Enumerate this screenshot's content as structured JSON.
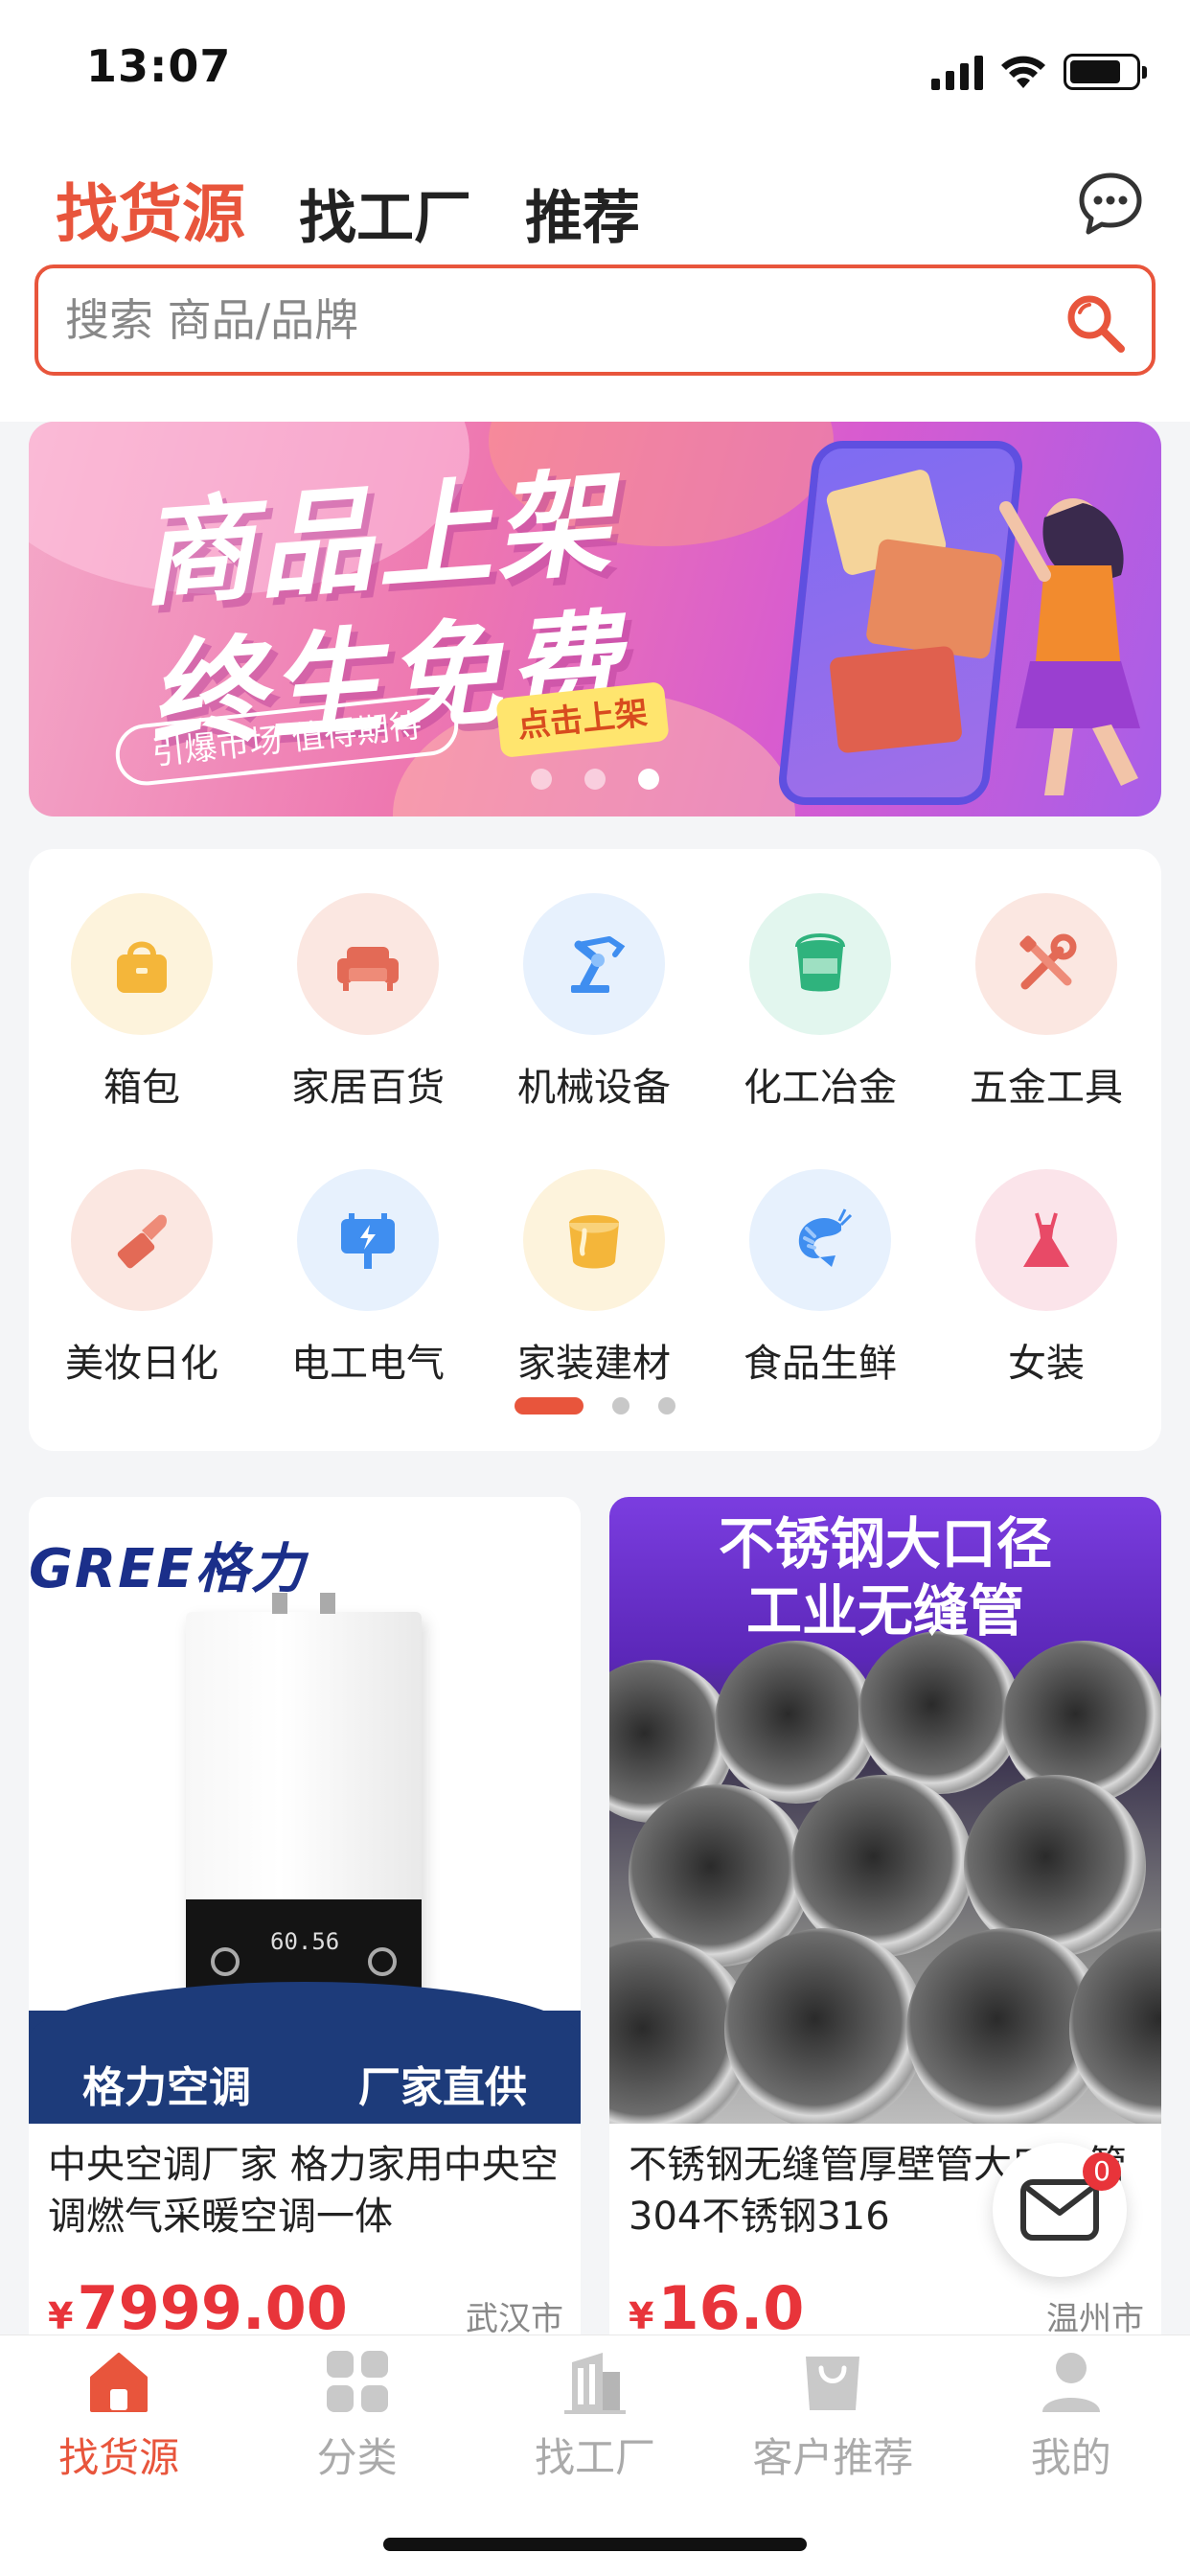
{
  "status_bar": {
    "time": "13:07"
  },
  "header": {
    "tabs": [
      {
        "label": "找货源",
        "active": true
      },
      {
        "label": "找工厂",
        "active": false
      },
      {
        "label": "推荐",
        "active": false
      }
    ],
    "message_icon": "chat-bubble-icon"
  },
  "search": {
    "placeholder": "搜索 商品/品牌",
    "icon": "search-icon"
  },
  "banner": {
    "title_line1": "商品上架",
    "title_line2": "终生免费",
    "subtitle": "引爆市场 值得期待",
    "cta": "点击上架",
    "page_count": 3,
    "active_page": 3
  },
  "categories": [
    {
      "label": "箱包",
      "icon": "bag-icon",
      "bg": "#fdf3dc",
      "color": "#f4b63a"
    },
    {
      "label": "家居百货",
      "icon": "sofa-icon",
      "bg": "#fbe7e1",
      "color": "#e36a56"
    },
    {
      "label": "机械设备",
      "icon": "robot-arm-icon",
      "bg": "#e7f1fd",
      "color": "#3f8ef0"
    },
    {
      "label": "化工冶金",
      "icon": "paint-bucket-icon",
      "bg": "#e2f6ee",
      "color": "#2fb37d"
    },
    {
      "label": "五金工具",
      "icon": "tools-icon",
      "bg": "#fbe7e1",
      "color": "#e36a56"
    },
    {
      "label": "美妆日化",
      "icon": "lipstick-icon",
      "bg": "#fbe7e1",
      "color": "#e36a56"
    },
    {
      "label": "电工电气",
      "icon": "electric-sign-icon",
      "bg": "#e7f1fd",
      "color": "#3f8ef0"
    },
    {
      "label": "家装建材",
      "icon": "paint-can-icon",
      "bg": "#fdf3dc",
      "color": "#f4b63a"
    },
    {
      "label": "食品生鲜",
      "icon": "shrimp-icon",
      "bg": "#e7f1fd",
      "color": "#3f8ef0"
    },
    {
      "label": "女装",
      "icon": "dress-icon",
      "bg": "#fbe4ea",
      "color": "#e84a67"
    }
  ],
  "category_pager": {
    "pages": 3,
    "active": 1
  },
  "products": [
    {
      "name": "中央空调厂家 格力家用中央空调燃气采暖空调一体",
      "price": "7999.00",
      "currency": "¥",
      "city": "武汉市",
      "image_brand": "GREE格力",
      "image_display": "60.56",
      "image_slogan_left": "格力空调",
      "image_slogan_right": "厂家直供"
    },
    {
      "name": "不锈钢无缝管厚壁管大口径管304不锈钢316",
      "price": "16.0",
      "currency": "¥",
      "city": "温州市",
      "image_title_line1": "不锈钢大口径",
      "image_title_line2": "工业无缝管"
    }
  ],
  "floating_message": {
    "badge": "0",
    "icon": "envelope-icon"
  },
  "tabbar": [
    {
      "label": "找货源",
      "icon": "home-icon",
      "active": true
    },
    {
      "label": "分类",
      "icon": "grid-icon",
      "active": false
    },
    {
      "label": "找工厂",
      "icon": "building-icon",
      "active": false
    },
    {
      "label": "客户推荐",
      "icon": "shopping-bag-icon",
      "active": false
    },
    {
      "label": "我的",
      "icon": "user-icon",
      "active": false
    }
  ],
  "colors": {
    "accent": "#e8553c",
    "price": "#e8343a"
  }
}
